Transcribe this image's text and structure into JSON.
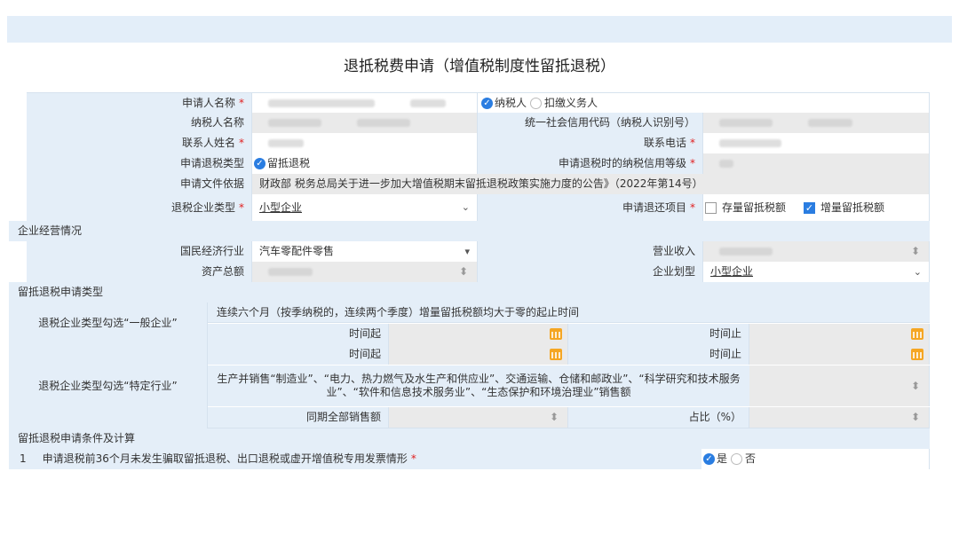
{
  "page": {
    "title": "退抵税费申请（增值税制度性留抵退税）"
  },
  "applicant": {
    "name_label": "申请人名称",
    "role_options": [
      "纳税人",
      "扣缴义务人"
    ],
    "taxpayer_name_label": "纳税人名称",
    "credit_code_label": "统一社会信用代码（纳税人识别号）",
    "contact_label": "联系人姓名",
    "phone_label": "联系电话",
    "refund_type_label": "申请退税类型",
    "refund_type_value": "留抵退税",
    "credit_grade_label": "申请退税时的纳税信用等级",
    "basis_label": "申请文件依据",
    "basis_value": "财政部 税务总局关于进一步加大增值税期末留抵退税政策实施力度的公告》（2022年第14号）",
    "enterprise_type_label": "退税企业类型",
    "enterprise_type_value": "小型企业",
    "refund_item_label": "申请退还项目",
    "refund_item_stock": "存量留抵税额",
    "refund_item_incremental": "增量留抵税额"
  },
  "business": {
    "section_title": "企业经营情况",
    "industry_label": "国民经济行业",
    "industry_value": "汽车零配件零售",
    "revenue_label": "营业收入",
    "assets_label": "资产总额",
    "division_label": "企业划型",
    "division_value": "小型企业"
  },
  "refund_type": {
    "section_title": "留抵退税申请类型",
    "general_label": "退税企业类型勾选“一般企业”",
    "general_desc": "连续六个月（按季纳税的，连续两个季度）增量留抵税额均大于零的起止时间",
    "time_start": "时间起",
    "time_end": "时间止",
    "special_label": "退税企业类型勾选“特定行业”",
    "special_desc": "生产并销售“制造业”、“电力、热力燃气及水生产和供应业”、交通运输、仓储和邮政业”、“科学研究和技术服务业”、“软件和信息技术服务业”、“生态保护和环境治理业”销售额",
    "total_sales_label": "同期全部销售额",
    "ratio_label": "占比（%）"
  },
  "conditions": {
    "section_title": "留抵退税申请条件及计算",
    "items": [
      {
        "no": "1",
        "text": "申请退税前36个月未发生骗取留抵退税、出口退税或虚开增值税专用发票情形",
        "yes": "是",
        "no_label": "否"
      }
    ]
  }
}
